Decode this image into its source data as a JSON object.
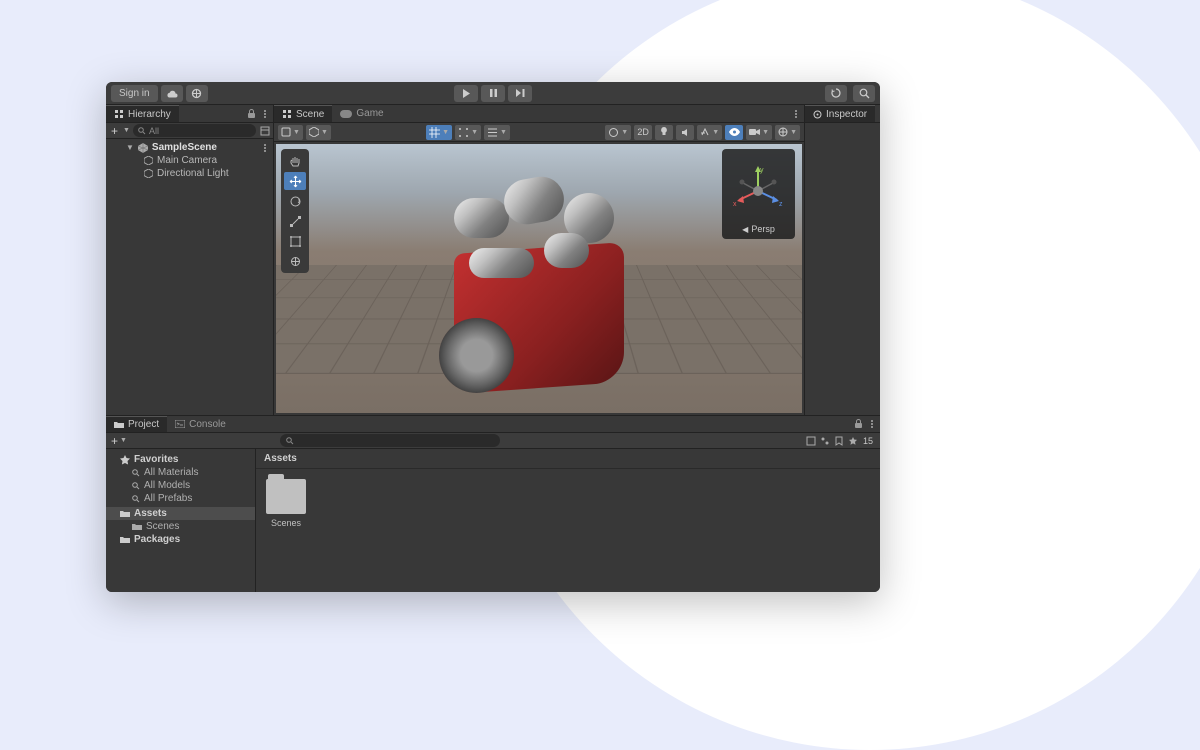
{
  "topbar": {
    "signin": "Sign in"
  },
  "hierarchy": {
    "tab_label": "Hierarchy",
    "search_placeholder": "All",
    "scene_name": "SampleScene",
    "items": [
      {
        "label": "Main Camera"
      },
      {
        "label": "Directional Light"
      }
    ]
  },
  "scene": {
    "tab_scene": "Scene",
    "tab_game": "Game",
    "btn_2d": "2D",
    "persp_label": "Persp"
  },
  "gizmo": {
    "x": "x",
    "y": "y",
    "z": "z"
  },
  "inspector": {
    "tab_label": "Inspector"
  },
  "project": {
    "tab_project": "Project",
    "tab_console": "Console",
    "favorites_label": "Favorites",
    "fav_items": [
      "All Materials",
      "All Models",
      "All Prefabs"
    ],
    "assets_label": "Assets",
    "scenes_folder": "Scenes",
    "packages_label": "Packages",
    "breadcrumb": "Assets",
    "folder_name": "Scenes",
    "visibility_count": "15"
  }
}
